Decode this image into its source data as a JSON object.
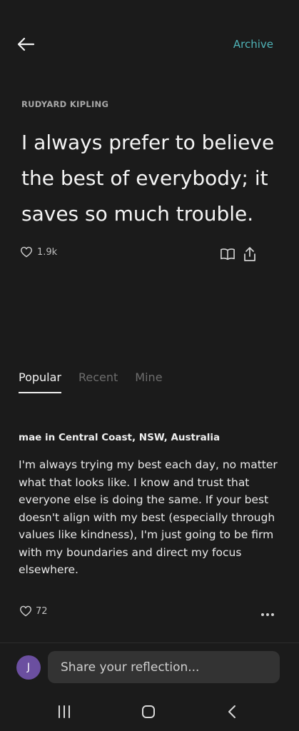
{
  "header": {
    "archive_label": "Archive"
  },
  "quote": {
    "author": "RUDYARD KIPLING",
    "text": "I always prefer to believe the best of everybody; it saves so much trouble.",
    "likes": "1.9k"
  },
  "tabs": [
    "Popular",
    "Recent",
    "Mine"
  ],
  "active_tab": "Popular",
  "reflection": {
    "author": "mae in Central Coast, NSW, Australia",
    "text": "I'm always trying my best each day, no matter what that looks like. I know and trust that everyone else is doing the same. If your best doesn't align with my best (especially through values like kindness), I'm just going to be firm with my boundaries and direct my focus elsewhere.",
    "likes": "72"
  },
  "composer": {
    "avatar_initial": "J",
    "placeholder": "Share your reflection..."
  },
  "colors": {
    "background": "#1b1b1b",
    "accent": "#4fb3b7",
    "avatar": "#6b4fa0",
    "input": "#333333"
  },
  "icons": [
    "arrow-left-icon",
    "heart-icon",
    "book-icon",
    "share-icon",
    "more-dots-icon",
    "recents-icon",
    "home-icon",
    "back-chevron-icon"
  ]
}
